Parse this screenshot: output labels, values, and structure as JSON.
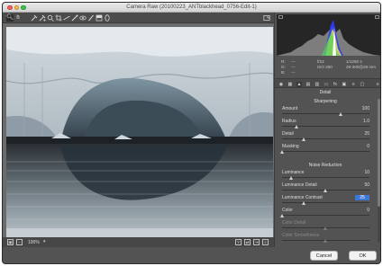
{
  "window": {
    "title": "Camera Raw (20100223_ANTblackhead_0756-Edit-1)"
  },
  "toolbar": {
    "tools": [
      "zoom-tool-icon",
      "hand-tool-icon",
      "white-balance-tool-icon",
      "color-sampler-tool-icon",
      "targeted-adjustment-tool-icon",
      "crop-tool-icon",
      "straighten-tool-icon",
      "spot-removal-tool-icon",
      "red-eye-tool-icon",
      "adjustment-brush-icon",
      "graduated-filter-icon",
      "radial-filter-icon"
    ],
    "fullscreen_icon": "fullscreen-toggle-icon"
  },
  "info": {
    "r_label": "R:",
    "r_value": "---",
    "g_label": "G:",
    "g_value": "---",
    "b_label": "B:",
    "b_value": "---",
    "aperture": "f/22",
    "shutter": "1/1250 s",
    "iso": "ISO 250",
    "lens": "28-300@28 mm"
  },
  "tabs": [
    "basic-tab-icon",
    "tone-curve-tab-icon",
    "detail-tab-icon",
    "hsl-tab-icon",
    "split-toning-tab-icon",
    "lens-corrections-tab-icon",
    "effects-tab-icon",
    "camera-calibration-tab-icon",
    "presets-tab-icon",
    "snapshots-tab-icon"
  ],
  "detail": {
    "panel_title": "Detail",
    "sharpening_title": "Sharpening",
    "noise_title": "Noise Reduction",
    "sharpening": [
      {
        "label": "Amount",
        "value": "100",
        "level": 0.667,
        "disabled": false,
        "selected": false
      },
      {
        "label": "Radius",
        "value": "1.0",
        "level": 0.167,
        "disabled": false,
        "selected": false
      },
      {
        "label": "Detail",
        "value": "25",
        "level": 0.25,
        "disabled": false,
        "selected": false
      },
      {
        "label": "Masking",
        "value": "0",
        "level": 0.0,
        "disabled": false,
        "selected": false
      }
    ],
    "noise": [
      {
        "label": "Luminance",
        "value": "10",
        "level": 0.1,
        "disabled": false,
        "selected": false
      },
      {
        "label": "Luminance Detail",
        "value": "50",
        "level": 0.5,
        "disabled": false,
        "selected": false
      },
      {
        "label": "Luminance Contrast",
        "value": "25",
        "level": 0.25,
        "disabled": false,
        "selected": true
      },
      {
        "label": "Color",
        "value": "0",
        "level": 0.0,
        "disabled": false,
        "selected": false
      },
      {
        "label": "Color Detail",
        "value": "",
        "level": 0.5,
        "disabled": true,
        "selected": false
      },
      {
        "label": "Color Smoothness",
        "value": "",
        "level": 0.5,
        "disabled": true,
        "selected": false
      }
    ]
  },
  "bottombar": {
    "zoom": "100%"
  },
  "buttons": {
    "cancel": "Cancel",
    "ok": "OK"
  }
}
